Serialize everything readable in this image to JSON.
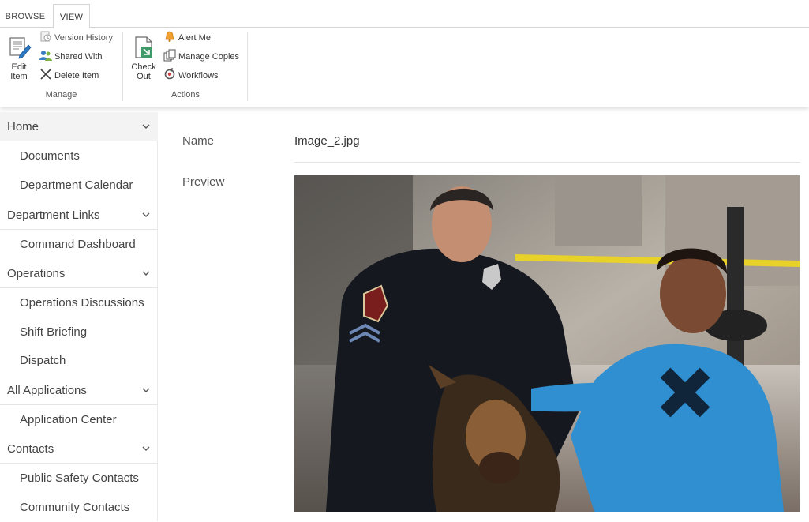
{
  "ribbon": {
    "tabs": [
      {
        "label": "BROWSE"
      },
      {
        "label": "VIEW"
      }
    ],
    "manage": {
      "group_label": "Manage",
      "edit_item": "Edit Item",
      "edit_item_line1": "Edit",
      "edit_item_line2": "Item",
      "version_history": "Version History",
      "shared_with": "Shared With",
      "delete_item": "Delete Item"
    },
    "actions": {
      "group_label": "Actions",
      "check_out_line1": "Check",
      "check_out_line2": "Out",
      "alert_me": "Alert Me",
      "manage_copies": "Manage Copies",
      "workflows": "Workflows"
    }
  },
  "nav": {
    "items": [
      {
        "label": "Home",
        "type": "heading"
      },
      {
        "label": "Documents",
        "type": "sub"
      },
      {
        "label": "Department Calendar",
        "type": "sub"
      },
      {
        "label": "Department Links",
        "type": "heading"
      },
      {
        "label": "Command Dashboard",
        "type": "sub"
      },
      {
        "label": "Operations",
        "type": "heading"
      },
      {
        "label": "Operations Discussions",
        "type": "sub"
      },
      {
        "label": "Shift Briefing",
        "type": "sub"
      },
      {
        "label": "Dispatch",
        "type": "sub"
      },
      {
        "label": "All Applications",
        "type": "heading"
      },
      {
        "label": "Application Center",
        "type": "sub"
      },
      {
        "label": "Contacts",
        "type": "heading"
      },
      {
        "label": "Public Safety Contacts",
        "type": "sub"
      },
      {
        "label": "Community Contacts",
        "type": "sub"
      }
    ]
  },
  "main": {
    "name_label": "Name",
    "name_value": "Image_2.jpg",
    "preview_label": "Preview",
    "preview_description": "Photo: police officer kneeling with a K-9 dog and a boy in a blue hoodie"
  },
  "colors": {
    "accent": "#0072c6",
    "nav_home_bg": "#f3f3f3",
    "text": "#333333"
  }
}
